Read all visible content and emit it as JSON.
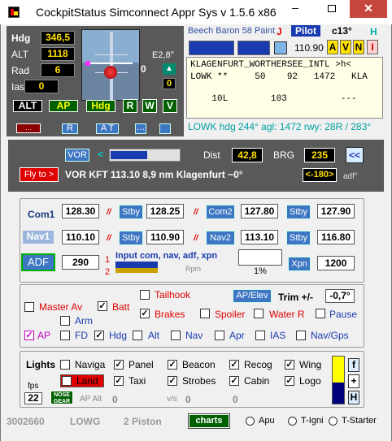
{
  "window": {
    "title": "CockpitStatus Simconnect Appr Sys v 1.5.6  x86"
  },
  "instruments": {
    "hdg_label": "Hdg",
    "hdg": "346,5",
    "alt_label": "ALT",
    "alt": "1118",
    "rad_label": "Rad",
    "rad": "6",
    "ias_label": "Ias",
    "ias": "0",
    "mini_value": "0",
    "alt_btn": "ALT",
    "ap_btn": "AP",
    "hdg_btn": "Hdg",
    "r_btn": "R",
    "w_btn": "W",
    "v_btn": "V",
    "small_r": "R",
    "small_at": "A T",
    "e_angle": "E2,8°",
    "attitude_0": "0",
    "small_0": "0"
  },
  "aircraft": {
    "name": "Beech Baron 58 Paint",
    "j": "J",
    "pilot": "Pilot",
    "temp": "c13°",
    "h": "H",
    "freq": "110.90",
    "a": "A",
    "v": "V",
    "n": "N",
    "i": "I",
    "airport_line1": "KLAGENFURT_WORTHERSEE_INTL >h<",
    "airport_line2": "LOWK **     50    92   1472   KLA",
    "airport_line3": "    10L        103          ---",
    "status": "LOWK hdg 244°   agl: 1472   rwy: 28R / 283°"
  },
  "nav": {
    "vor_btn": "VOR",
    "arrow_left": "<",
    "dist_label": "Dist",
    "dist": "42,8",
    "brg_label": "BRG",
    "brg": "235",
    "back_btn": "<<",
    "fly_btn": "Fly to >",
    "vor_info": "VOR KFT 113.10   8,9 nm Klagenfurt ~0°",
    "recip": "<-180>",
    "adf_deg": "adf°",
    "vor_progress": 0.53
  },
  "radios": {
    "com1_label": "Com1",
    "com1": "128.30",
    "com1_stby_btn": "Stby",
    "com1_stby": "128.25",
    "com2_btn": "Com2",
    "com2": "127.80",
    "com2_stby_btn": "Stby",
    "com2_stby": "127.90",
    "nav1_label": "Nav1",
    "nav1": "110.10",
    "nav1_stby_btn": "Stby",
    "nav1_stby": "110.90",
    "nav2_btn": "Nav2",
    "nav2": "113.10",
    "nav2_stby_btn": "Stby",
    "nav2_stby": "116.80",
    "swap": "//",
    "adf_btn": "ADF",
    "adf": "290",
    "one": "1",
    "two": "2",
    "input_label": "Input com, nav, adf, xpn",
    "rpm_label": "Rpm",
    "pct": "1%",
    "xpn_btn": "Xpn",
    "xpn": "1200"
  },
  "flight": {
    "tailhook": "Tailhook",
    "ap_elev_btn": "AP/Elev",
    "trim_label": "Trim +/-",
    "trim": "-0,7°",
    "master_av": "Master Av",
    "batt": "Batt",
    "brakes": "Brakes",
    "spoiler": "Spoiler",
    "water_r": "Water R",
    "pause": "Pause",
    "arm": "Arm",
    "ap": "AP",
    "fd": "FD",
    "hdg": "Hdg",
    "alt": "Alt",
    "nav": "Nav",
    "apr": "Apr",
    "ias": "IAS",
    "nav_gps": "Nav/Gps"
  },
  "lights": {
    "title": "Lights",
    "naviga": "Naviga",
    "panel": "Panel",
    "beacon": "Beacon",
    "recog": "Recog",
    "wing": "Wing",
    "land": "Land",
    "taxi": "Taxi",
    "strobes": "Strobes",
    "cabin": "Cabin",
    "logo": "Logo",
    "fps_label": "fps",
    "fps": "22",
    "nose_gear": "NOSE GEAR",
    "ap_alt_label": "AP Alt",
    "ap_alt": "0",
    "vs_label": "v/s",
    "vs": "0",
    "last": "0",
    "f_btn": "f",
    "plus_btn": "+",
    "h_btn": "H"
  },
  "bottom": {
    "id": "3002660",
    "airport": "LOWG",
    "engine": "2 Piston",
    "charts_btn": "charts",
    "apu": "Apu",
    "t_igni": "T-Igni",
    "t_starter": "T-Starter"
  },
  "colors": {
    "yellow_display": "#ffe000",
    "btn_blue": "#3d76c2",
    "green_btn": "#006000",
    "red": "#e00000",
    "magenta": "#c000c0"
  }
}
